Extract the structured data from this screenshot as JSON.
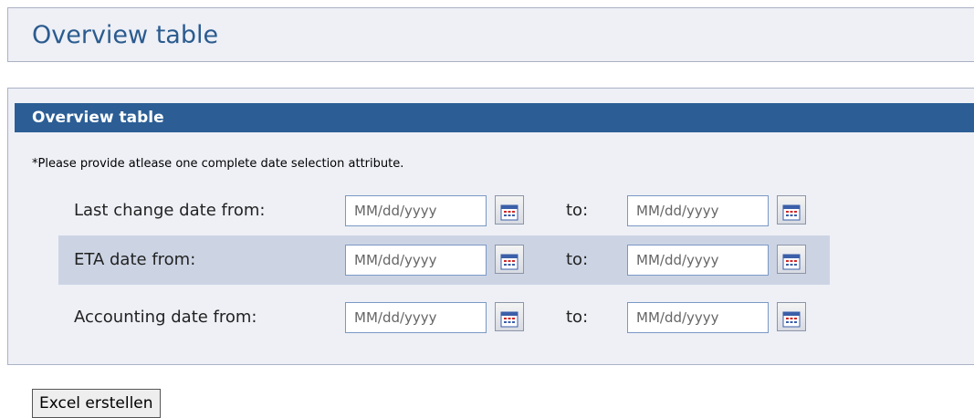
{
  "page": {
    "title": "Overview table"
  },
  "panel": {
    "title": "Overview table",
    "hint": "*Please provide atlease one complete date selection attribute.",
    "rows": [
      {
        "label": "Last change date from:",
        "from_placeholder": "MM/dd/yyyy",
        "to_label": "to:",
        "to_placeholder": "MM/dd/yyyy"
      },
      {
        "label": "ETA date from:",
        "from_placeholder": "MM/dd/yyyy",
        "to_label": "to:",
        "to_placeholder": "MM/dd/yyyy"
      },
      {
        "label": "Accounting date from:",
        "from_placeholder": "MM/dd/yyyy",
        "to_label": "to:",
        "to_placeholder": "MM/dd/yyyy"
      }
    ],
    "calendar_icon": "calendar-icon"
  },
  "actions": {
    "excel_label": "Excel erstellen"
  },
  "colors": {
    "accent": "#2c5e95",
    "title": "#2b5b8e",
    "alt_row": "#ccd4e4",
    "panel_bg": "#eef0f6"
  }
}
